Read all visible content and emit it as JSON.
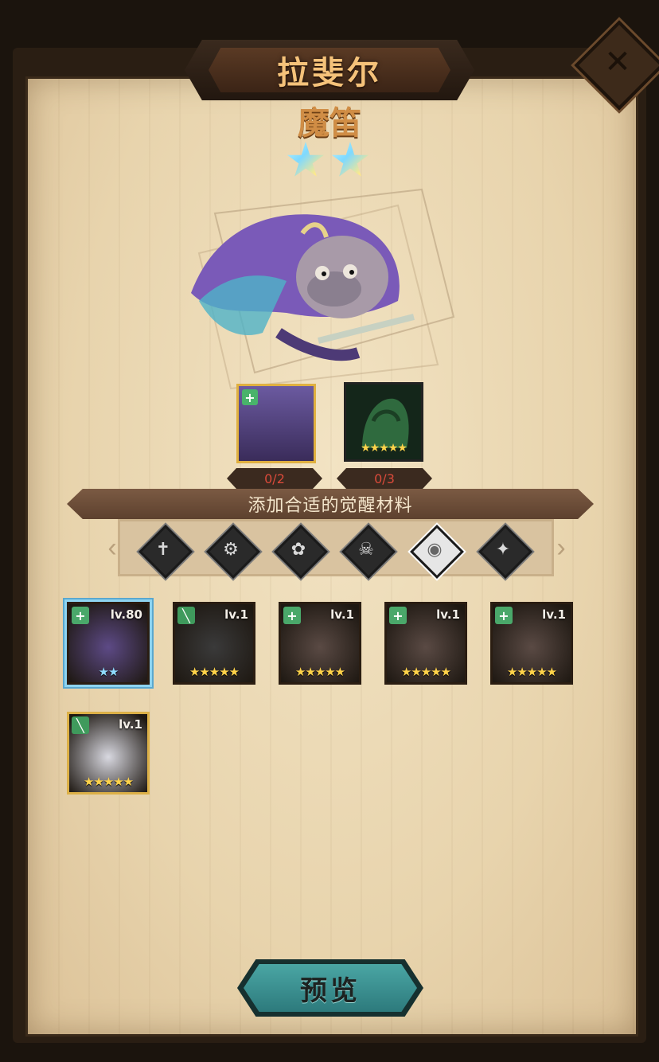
{
  "header": {
    "title": "拉斐尔",
    "close_icon": "close-x-icon"
  },
  "hero": {
    "class_name": "魔笛",
    "star_count": 2,
    "star_color": "#7ed9ff"
  },
  "materials": [
    {
      "name": "same-hero-slot",
      "count": "0/2",
      "badge": "plus"
    },
    {
      "name": "five-star-green-slot",
      "count": "0/3",
      "stars": "★★★★★"
    }
  ],
  "banner": {
    "text": "添加合适的觉醒材料"
  },
  "faction_filters": [
    {
      "icon": "cross-faction-icon",
      "glyph": "✝",
      "active": false
    },
    {
      "icon": "gear-faction-icon",
      "glyph": "⚙",
      "active": false
    },
    {
      "icon": "flower-faction-icon",
      "glyph": "✿",
      "active": false
    },
    {
      "icon": "skull-faction-icon",
      "glyph": "☠",
      "active": false
    },
    {
      "icon": "eye-faction-icon",
      "glyph": "◉",
      "active": true
    },
    {
      "icon": "star-faction-icon",
      "glyph": "✦",
      "active": false
    }
  ],
  "heroes": [
    {
      "level": "lv.80",
      "stars": "★★",
      "badge": "+",
      "badge_type": "plus",
      "selected": true,
      "gold": false,
      "color": "#5d4a86"
    },
    {
      "level": "lv.1",
      "stars": "★★★★★",
      "badge": "╲",
      "badge_type": "slash",
      "selected": false,
      "gold": false,
      "color": "#3a3a3a"
    },
    {
      "level": "lv.1",
      "stars": "★★★★★",
      "badge": "+",
      "badge_type": "plus",
      "selected": false,
      "gold": false,
      "color": "#5a4a44"
    },
    {
      "level": "lv.1",
      "stars": "★★★★★",
      "badge": "+",
      "badge_type": "plus",
      "selected": false,
      "gold": false,
      "color": "#5a4a44"
    },
    {
      "level": "lv.1",
      "stars": "★★★★★",
      "badge": "+",
      "badge_type": "plus",
      "selected": false,
      "gold": false,
      "color": "#5a4a44"
    },
    {
      "level": "lv.1",
      "stars": "★★★★★",
      "badge": "╲",
      "badge_type": "slash",
      "selected": false,
      "gold": true,
      "color": "#d8d8e0"
    }
  ],
  "footer": {
    "preview_label": "预览"
  }
}
